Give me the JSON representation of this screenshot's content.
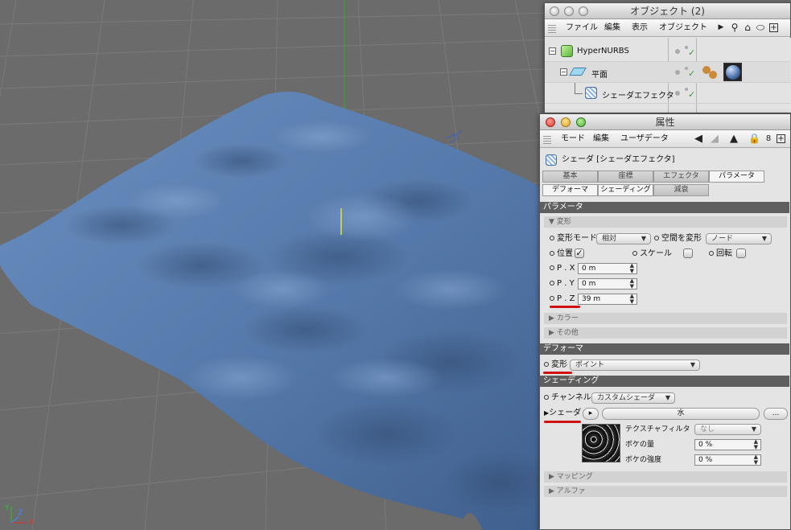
{
  "viewport": {
    "axis_labels": {
      "y": "Y",
      "z": "Z",
      "x": "X"
    }
  },
  "object_manager": {
    "title": "オブジェクト (2)",
    "menu": [
      "ファイル",
      "編集",
      "表示",
      "オブジェクト"
    ],
    "toolbar_icons": [
      "triangle-right-icon",
      "search-icon",
      "home-icon",
      "oval-icon",
      "expand-icon"
    ],
    "tree": [
      {
        "name": "HyperNURBS",
        "icon": "hypernurbs-icon",
        "depth": 0
      },
      {
        "name": "平面",
        "icon": "plane-icon",
        "depth": 1
      },
      {
        "name": "シェーダエフェクタ",
        "icon": "shader-effector-icon",
        "depth": 2
      }
    ],
    "tags": [
      "material-tag-icon",
      "sphere-material-icon"
    ]
  },
  "attributes": {
    "title": "属性",
    "menu": [
      "モード",
      "編集",
      "ユーザデータ"
    ],
    "toolbar_icons": [
      "back-arrow-icon",
      "forward-arrow-icon",
      "up-arrow-icon",
      "lock-icon",
      "link-icon",
      "new-icon"
    ],
    "object_label": "シェーダ [シェーダエフェクタ]",
    "tabs_row1": [
      "基本",
      "座標",
      "エフェクタ",
      "パラメータ"
    ],
    "tabs_row2": [
      "デフォーマ",
      "シェーディング",
      "減衰"
    ],
    "active_tab": "パラメータ",
    "sections": {
      "parameters": "パラメータ",
      "deformer": "デフォーマ",
      "shading": "シェーディング"
    },
    "transform": {
      "group": "▼ 変形",
      "mode_label": "変形モード",
      "mode_value": "相対",
      "space_label": "空間を変形",
      "space_value": "ノード",
      "position_label": "位置",
      "position_checked": true,
      "scale_label": "スケール",
      "rotation_label": "回転",
      "px_label": "P . X",
      "px_value": "0 m",
      "py_label": "P . Y",
      "py_value": "0 m",
      "pz_label": "P . Z",
      "pz_value": "39 m"
    },
    "collapsed_groups": [
      "▶ カラー",
      "▶ その他"
    ],
    "deformer": {
      "label": "変形",
      "value": "ポイント"
    },
    "shading": {
      "channel_label": "チャンネル",
      "channel_value": "カスタムシェーダ",
      "shader_label": "シェーダ",
      "shader_value": "水",
      "more_button": "...",
      "texture_filter_label": "テクスチャフィルタ",
      "texture_filter_value": "なし",
      "blur_amount_label": "ボケの量",
      "blur_amount_value": "0 %",
      "blur_strength_label": "ボケの強度",
      "blur_strength_value": "0 %"
    },
    "bottom_groups": [
      "▶ マッピング",
      "▶ アルファ"
    ]
  },
  "colors": {
    "viewport_bg": "#6b6b6b",
    "surface": "#5a7fb0",
    "section_bar": "#5f5f5f",
    "annotation": "#d21010"
  }
}
